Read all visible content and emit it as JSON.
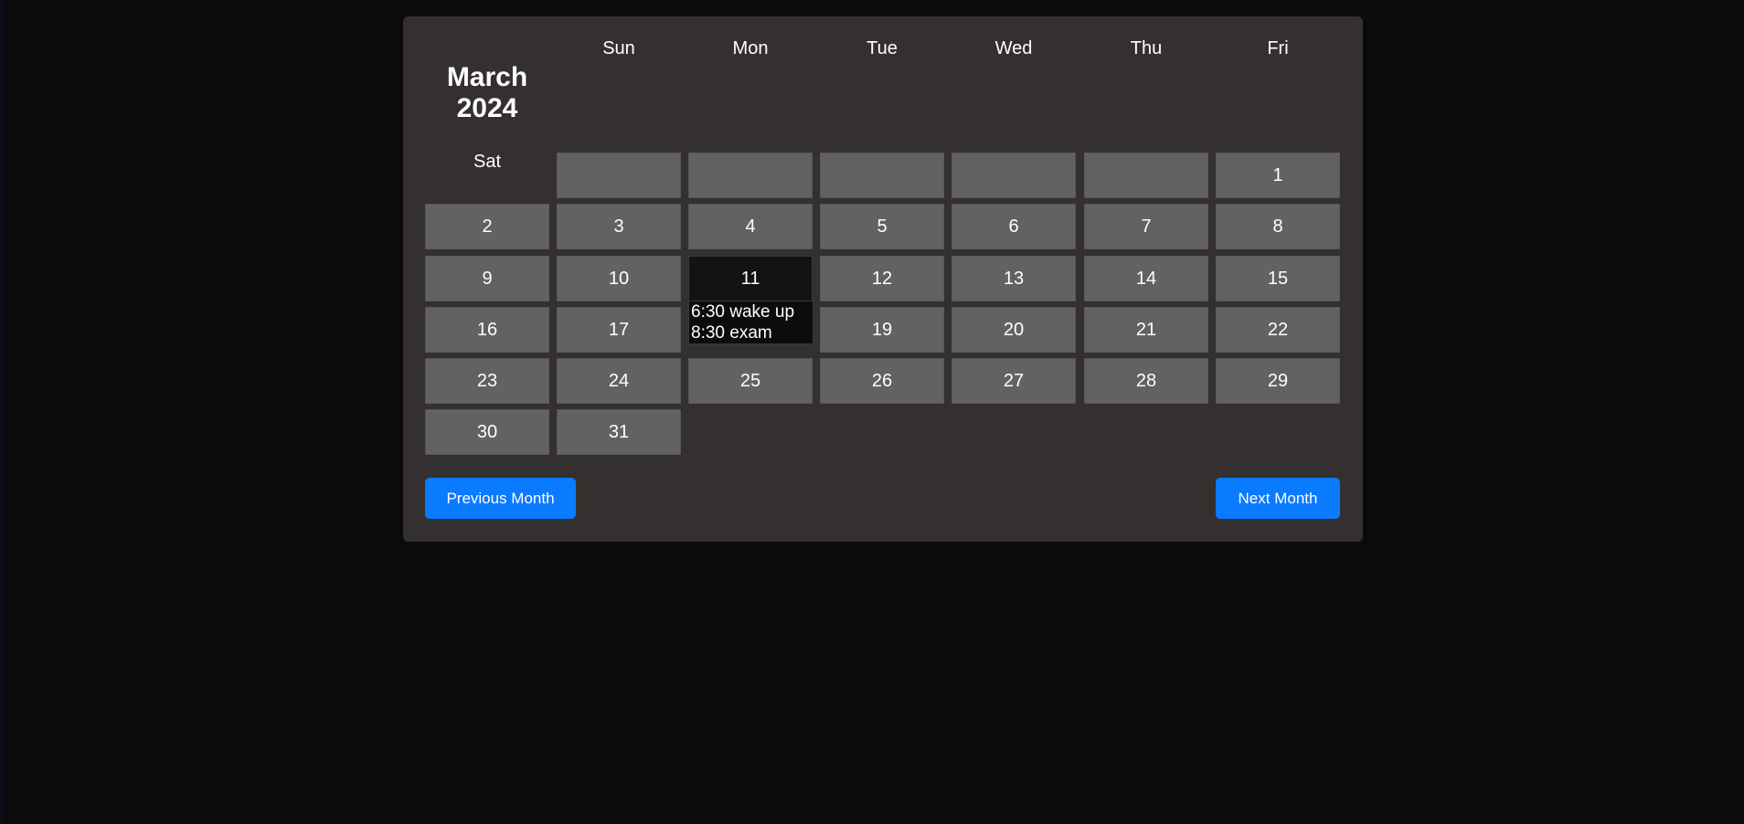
{
  "calendar": {
    "title": "March 2024",
    "days_of_week": [
      "Sun",
      "Mon",
      "Tue",
      "Wed",
      "Thu",
      "Fri"
    ],
    "sat_label": "Sat",
    "weeks": [
      [
        "",
        "",
        "",
        "",
        "",
        "",
        "1"
      ],
      [
        "2",
        "3",
        "4",
        "5",
        "6",
        "7",
        "8"
      ],
      [
        "9",
        "10",
        "11",
        "12",
        "13",
        "14",
        "15"
      ],
      [
        "16",
        "17",
        "",
        "19",
        "20",
        "21",
        "22"
      ],
      [
        "23",
        "24",
        "25",
        "26",
        "27",
        "28",
        "29"
      ],
      [
        "30",
        "31"
      ]
    ],
    "selected_day": "11",
    "events": [
      "6:30 wake up",
      "8:30 exam"
    ],
    "prev_button": "Previous Month",
    "next_button": "Next Month"
  },
  "colors": {
    "page_background": "#0b0b0b",
    "panel_background": "#353030",
    "cell_background": "#626262",
    "selected_background": "#141212",
    "button_background": "#0a7aff"
  }
}
